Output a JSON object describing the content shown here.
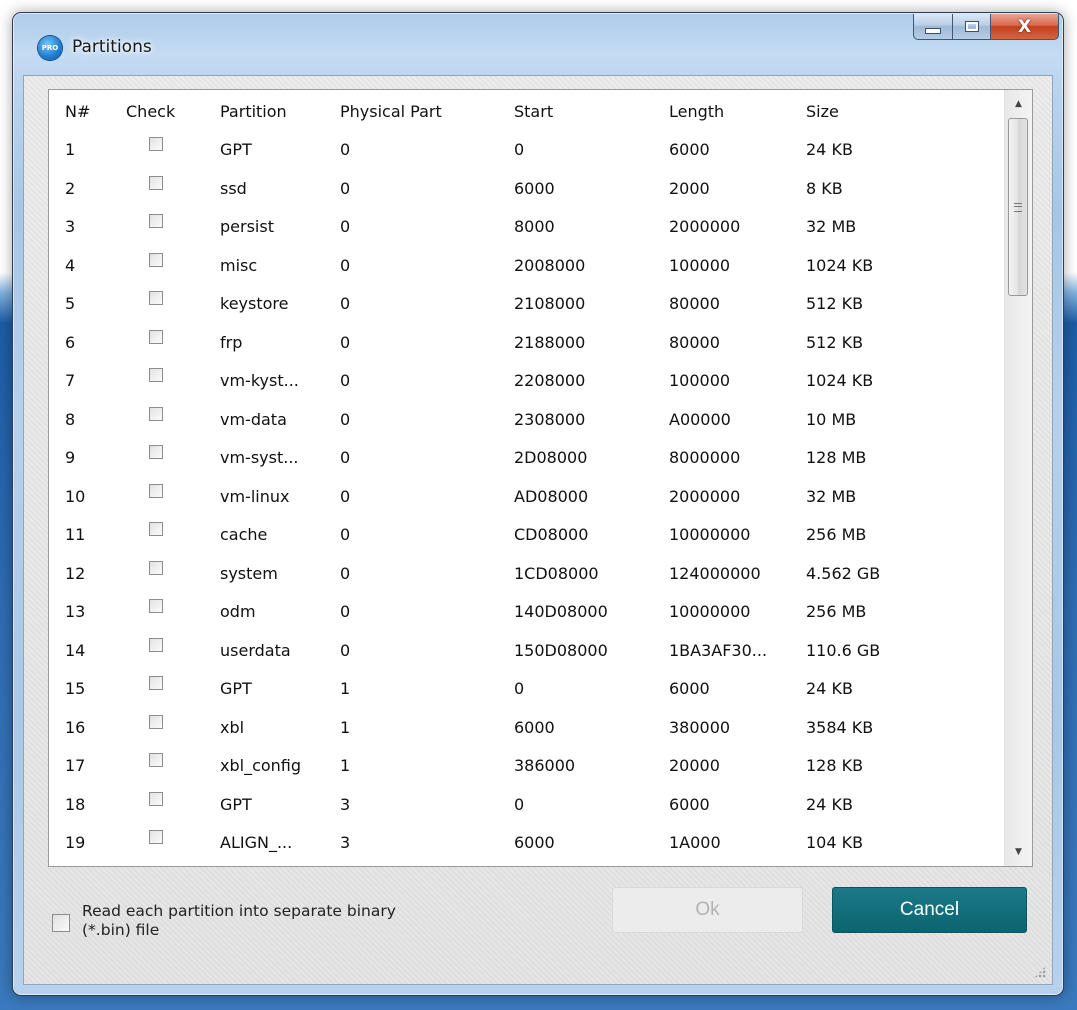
{
  "window": {
    "title": "Partitions",
    "icon_text": "PRO",
    "close_glyph": "X"
  },
  "table": {
    "headers": {
      "n": "N#",
      "check": "Check",
      "partition": "Partition",
      "physical": "Physical Part",
      "start": "Start",
      "length": "Length",
      "size": "Size"
    },
    "rows": [
      {
        "n": "1",
        "partition": "GPT",
        "physical": "0",
        "start": "0",
        "length": "6000",
        "size": "24 KB",
        "checked": false
      },
      {
        "n": "2",
        "partition": "ssd",
        "physical": "0",
        "start": "6000",
        "length": "2000",
        "size": "8 KB",
        "checked": false
      },
      {
        "n": "3",
        "partition": "persist",
        "physical": "0",
        "start": "8000",
        "length": "2000000",
        "size": "32 MB",
        "checked": false
      },
      {
        "n": "4",
        "partition": "misc",
        "physical": "0",
        "start": "2008000",
        "length": "100000",
        "size": "1024 KB",
        "checked": false
      },
      {
        "n": "5",
        "partition": "keystore",
        "physical": "0",
        "start": "2108000",
        "length": "80000",
        "size": "512 KB",
        "checked": false
      },
      {
        "n": "6",
        "partition": "frp",
        "physical": "0",
        "start": "2188000",
        "length": "80000",
        "size": "512 KB",
        "checked": false
      },
      {
        "n": "7",
        "partition": "vm-kyst...",
        "physical": "0",
        "start": "2208000",
        "length": "100000",
        "size": "1024 KB",
        "checked": false
      },
      {
        "n": "8",
        "partition": "vm-data",
        "physical": "0",
        "start": "2308000",
        "length": "A00000",
        "size": "10 MB",
        "checked": false
      },
      {
        "n": "9",
        "partition": "vm-syst...",
        "physical": "0",
        "start": "2D08000",
        "length": "8000000",
        "size": "128 MB",
        "checked": false
      },
      {
        "n": "10",
        "partition": "vm-linux",
        "physical": "0",
        "start": "AD08000",
        "length": "2000000",
        "size": "32 MB",
        "checked": false
      },
      {
        "n": "11",
        "partition": "cache",
        "physical": "0",
        "start": "CD08000",
        "length": "10000000",
        "size": "256 MB",
        "checked": false
      },
      {
        "n": "12",
        "partition": "system",
        "physical": "0",
        "start": "1CD08000",
        "length": "124000000",
        "size": "4.562 GB",
        "checked": false
      },
      {
        "n": "13",
        "partition": "odm",
        "physical": "0",
        "start": "140D08000",
        "length": "10000000",
        "size": "256 MB",
        "checked": false
      },
      {
        "n": "14",
        "partition": "userdata",
        "physical": "0",
        "start": "150D08000",
        "length": "1BA3AF30...",
        "size": "110.6 GB",
        "checked": false
      },
      {
        "n": "15",
        "partition": "GPT",
        "physical": "1",
        "start": "0",
        "length": "6000",
        "size": "24 KB",
        "checked": false
      },
      {
        "n": "16",
        "partition": "xbl",
        "physical": "1",
        "start": "6000",
        "length": "380000",
        "size": "3584 KB",
        "checked": false
      },
      {
        "n": "17",
        "partition": "xbl_config",
        "physical": "1",
        "start": "386000",
        "length": "20000",
        "size": "128 KB",
        "checked": false
      },
      {
        "n": "18",
        "partition": "GPT",
        "physical": "3",
        "start": "0",
        "length": "6000",
        "size": "24 KB",
        "checked": false
      },
      {
        "n": "19",
        "partition": "ALIGN_...",
        "physical": "3",
        "start": "6000",
        "length": "1A000",
        "size": "104 KB",
        "checked": false
      }
    ]
  },
  "options": {
    "separate_bin_label": "Read each partition into separate binary (*.bin) file",
    "separate_bin_checked": false
  },
  "buttons": {
    "ok_label": "Ok",
    "ok_enabled": false,
    "cancel_label": "Cancel"
  },
  "colors": {
    "cancel_button": "#0c6470",
    "ok_disabled_text": "#b3b3b3",
    "close_button": "#c2401f"
  },
  "icons": {
    "app": "pro-app-icon",
    "minimize": "minimize-icon",
    "maximize": "maximize-icon",
    "close": "close-icon",
    "scroll_up": "scroll-up-icon",
    "scroll_down": "scroll-down-icon"
  }
}
